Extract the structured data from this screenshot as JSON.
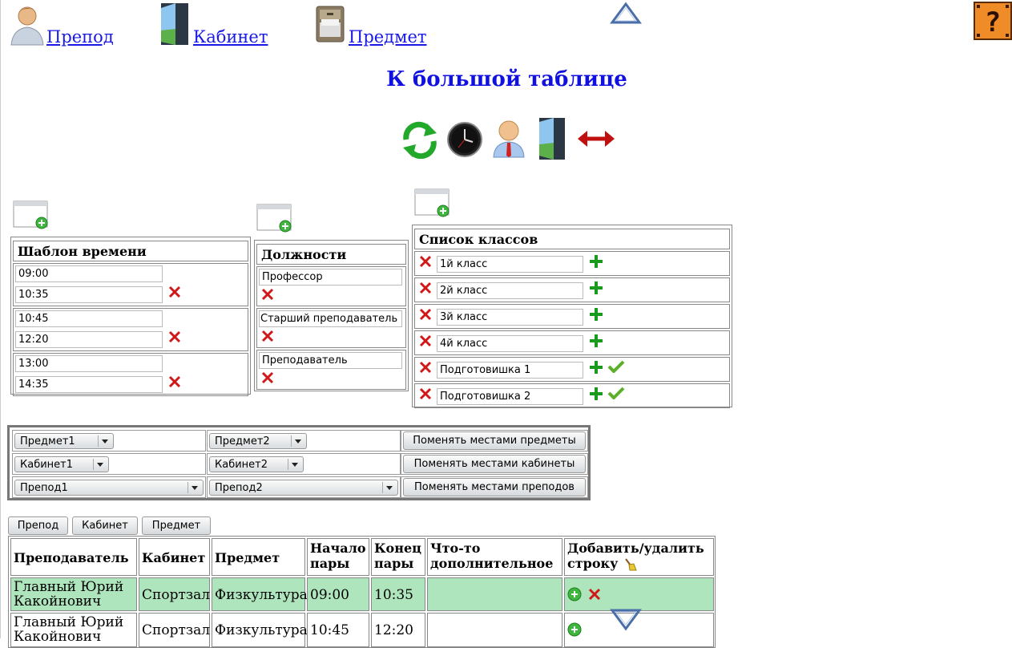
{
  "nav": {
    "items": [
      {
        "label": "Препод",
        "icon": "teacher-icon"
      },
      {
        "label": "Кабинет",
        "icon": "door-icon"
      },
      {
        "label": "Предмет",
        "icon": "cabinet-icon"
      }
    ]
  },
  "page_title": "К большой таблице",
  "toolbar_icons": [
    "refresh-icon",
    "clock-icon",
    "person-icon",
    "door-icon",
    "swap-arrows-icon"
  ],
  "time_template": {
    "title": "Шаблон времени",
    "slots": [
      {
        "start": "09:00",
        "end": "10:35"
      },
      {
        "start": "10:45",
        "end": "12:20"
      },
      {
        "start": "13:00",
        "end": "14:35"
      }
    ]
  },
  "positions": {
    "title": "Должности",
    "items": [
      "Профессор",
      "Старший преподаватель",
      "Преподаватель"
    ]
  },
  "classes": {
    "title": "Список классов",
    "items": [
      {
        "name": "1й класс",
        "checked": false
      },
      {
        "name": "2й класс",
        "checked": false
      },
      {
        "name": "3й класс",
        "checked": false
      },
      {
        "name": "4й класс",
        "checked": false
      },
      {
        "name": "Подготовишка 1",
        "checked": true
      },
      {
        "name": "Подготовишка 2",
        "checked": true
      }
    ]
  },
  "swap": {
    "subject1": "Предмет1",
    "subject2": "Предмет2",
    "swap_subjects": "Поменять местами предметы",
    "room1": "Кабинет1",
    "room2": "Кабинет2",
    "swap_rooms": "Поменять местами кабинеты",
    "teacher1": "Препод1",
    "teacher2": "Препод2",
    "swap_teachers": "Поменять местами преподов"
  },
  "tabs": [
    "Препод",
    "Кабинет",
    "Предмет"
  ],
  "schedule": {
    "headers": {
      "teacher": "Преподаватель",
      "room": "Кабинет",
      "subject": "Предмет",
      "start_1": "Начало",
      "start_2": "пары",
      "end_1": "Конец",
      "end_2": "пары",
      "extra_1": "Что-то",
      "extra_2": "дополнительное",
      "addrem_1": "Добавить/удалить",
      "addrem_2": "строку"
    },
    "rows": [
      {
        "teacher_1": "Главный Юрий",
        "teacher_2": "Какойнович",
        "room": "Спортзал",
        "subject": "Физкультура",
        "start": "09:00",
        "end": "10:35",
        "extra": "",
        "highlight": "#afe5bd"
      },
      {
        "teacher_1": "Главный Юрий",
        "teacher_2": "Какойнович",
        "room": "Спортзал",
        "subject": "Физкультура",
        "start": "10:45",
        "end": "12:20",
        "extra": ""
      }
    ]
  },
  "colors": {
    "link": "#1a1ae6",
    "title": "#1010e0",
    "row_highlight": "#afe5bd",
    "plus": "#1a9a1a",
    "delete": "#d01818"
  }
}
